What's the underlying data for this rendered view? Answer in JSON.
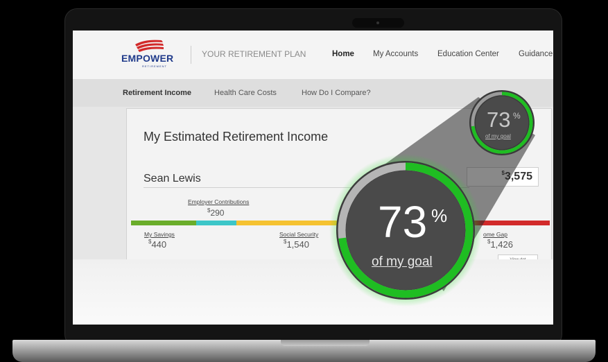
{
  "brand": {
    "name": "EMPOWER",
    "sub": "RETIREMENT",
    "plan": "YOUR RETIREMENT PLAN"
  },
  "nav": [
    "Home",
    "My Accounts",
    "Education Center",
    "Guidance"
  ],
  "subnav": [
    "Retirement Income",
    "Health Care Costs",
    "How Do I Compare?"
  ],
  "card": {
    "title": "My Estimated Retirement Income",
    "person": "Sean Lewis",
    "monthly_total": {
      "currency": "$",
      "value": "3,575"
    },
    "employer_contributions": {
      "label": "Employer Contributions",
      "currency": "$",
      "value": "290"
    },
    "my_savings": {
      "label": "My Savings",
      "currency": "$",
      "value": "440"
    },
    "social_security": {
      "label": "Social Security",
      "currency": "$",
      "value": "1,540"
    },
    "income_gap": {
      "label": "ome Gap",
      "currency": "$",
      "value": "1,426"
    },
    "view_button": "View det"
  },
  "goal": {
    "percent": 73,
    "percent_text": "73",
    "percent_sign": "%",
    "caption": "of my goal"
  },
  "colors": {
    "savings": "#6aad2a",
    "employer": "#3cc6c8",
    "social_security": "#f5c231",
    "gap": "#d22a2a",
    "gauge_green": "#1fbd22",
    "brand_blue": "#1f3a8a"
  }
}
